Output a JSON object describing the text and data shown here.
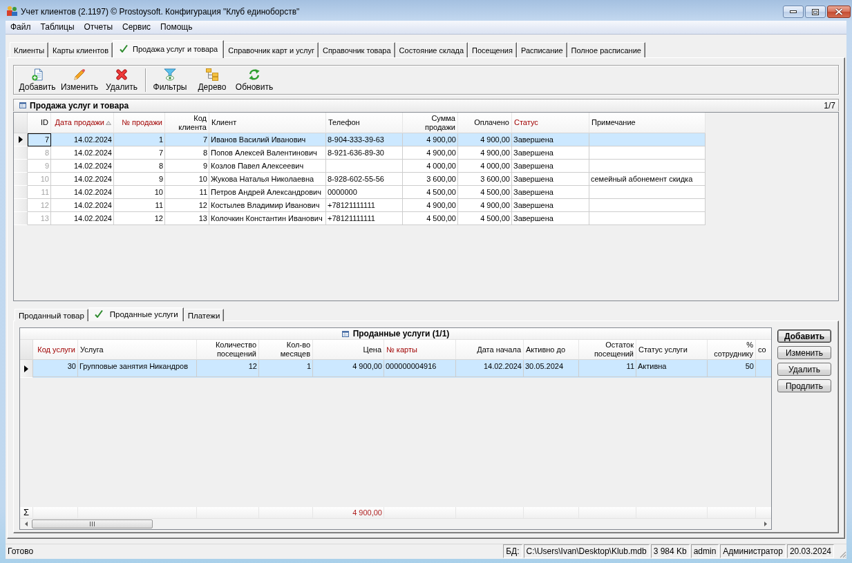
{
  "window": {
    "title": "Учет клиентов (2.1197) © Prostoysoft. Конфигурация \"Клуб единоборств\""
  },
  "menu": [
    {
      "label": "Файл"
    },
    {
      "label": "Таблицы"
    },
    {
      "label": "Отчеты"
    },
    {
      "label": "Сервис"
    },
    {
      "label": "Помощь"
    }
  ],
  "tabs": [
    {
      "label": "Клиенты",
      "selected": false
    },
    {
      "label": "Карты клиентов",
      "selected": false
    },
    {
      "label": "Продажа услуг и товара",
      "selected": true
    },
    {
      "label": "Справочник карт и услуг",
      "selected": false
    },
    {
      "label": "Справочник товара",
      "selected": false
    },
    {
      "label": "Состояние склада",
      "selected": false
    },
    {
      "label": "Посещения",
      "selected": false
    },
    {
      "label": "Расписание",
      "selected": false
    },
    {
      "label": "Полное расписание",
      "selected": false
    }
  ],
  "toolbar": {
    "groups": [
      [
        {
          "label": "Добавить",
          "kind": "add"
        },
        {
          "label": "Изменить",
          "kind": "edit"
        },
        {
          "label": "Удалить",
          "kind": "delete"
        }
      ],
      [
        {
          "label": "Фильтры",
          "kind": "filter"
        },
        {
          "label": "Дерево",
          "kind": "tree"
        },
        {
          "label": "Обновить",
          "kind": "refresh"
        }
      ]
    ]
  },
  "sales_panel": {
    "title": "Продажа услуг и товара",
    "counter": "1/7",
    "columns": [
      {
        "label": "ID",
        "highlighted": false,
        "sorted": false,
        "dimmed": true
      },
      {
        "label": "Дата продажи",
        "highlighted": true,
        "sorted": true,
        "dimmed": false
      },
      {
        "label": "№ продажи",
        "highlighted": true,
        "sorted": false,
        "dimmed": false
      },
      {
        "label": "Код\nклиента",
        "highlighted": false,
        "sorted": false,
        "dimmed": false
      },
      {
        "label": "Клиент",
        "highlighted": false,
        "sorted": false,
        "dimmed": false
      },
      {
        "label": "Телефон",
        "highlighted": false,
        "sorted": false,
        "dimmed": false
      },
      {
        "label": "Сумма\nпродажи",
        "highlighted": false,
        "sorted": false,
        "dimmed": false
      },
      {
        "label": "Оплачено",
        "highlighted": false,
        "sorted": false,
        "dimmed": false
      },
      {
        "label": "Статус",
        "highlighted": true,
        "sorted": false,
        "dimmed": false
      },
      {
        "label": "Примечание",
        "highlighted": false,
        "sorted": false,
        "dimmed": false
      }
    ],
    "rows": [
      {
        "selected": true,
        "cells": [
          "7",
          "14.02.2024",
          "1",
          "7",
          "Иванов Василий Иванович",
          "8-904-333-39-63",
          "4 900,00",
          "4 900,00",
          "Завершена",
          null
        ]
      },
      {
        "selected": false,
        "cells": [
          "8",
          "14.02.2024",
          "7",
          "8",
          "Попов Алексей Валентинович",
          "8-921-636-89-30",
          "4 900,00",
          "4 900,00",
          "Завершена",
          null
        ]
      },
      {
        "selected": false,
        "cells": [
          "9",
          "14.02.2024",
          "8",
          "9",
          "Козлов Павел Алексеевич",
          null,
          "4 000,00",
          "4 000,00",
          "Завершена",
          null
        ]
      },
      {
        "selected": false,
        "cells": [
          "10",
          "14.02.2024",
          "9",
          "10",
          "Жукова Наталья Николаевна",
          "8-928-602-55-56",
          "3 600,00",
          "3 600,00",
          "Завершена",
          "семейный абонемент скидка"
        ]
      },
      {
        "selected": false,
        "cells": [
          "11",
          "14.02.2024",
          "10",
          "11",
          "Петров Андрей Александрович",
          "0000000",
          "4 500,00",
          "4 500,00",
          "Завершена",
          null
        ]
      },
      {
        "selected": false,
        "cells": [
          "12",
          "14.02.2024",
          "11",
          "12",
          "Костылев Владимир Иванович",
          "+78121111111",
          "4 900,00",
          "4 900,00",
          "Завершена",
          null
        ]
      },
      {
        "selected": false,
        "cells": [
          "13",
          "14.02.2024",
          "12",
          "13",
          "Колочкин Константин Иванович",
          "+78121111111",
          "4 500,00",
          "4 500,00",
          "Завершена",
          null
        ]
      }
    ]
  },
  "detail_tabs": [
    {
      "label": "Проданный товар",
      "selected": false
    },
    {
      "label": "Проданные услуги",
      "selected": true
    },
    {
      "label": "Платежи",
      "selected": false
    }
  ],
  "services_panel": {
    "title": "Проданные услуги (1/1)",
    "totals_label": "Σ",
    "columns": [
      {
        "label": "Код услуги",
        "highlighted": true
      },
      {
        "label": "Услуга",
        "highlighted": false
      },
      {
        "label": "Количество\nпосещений",
        "highlighted": false
      },
      {
        "label": "Кол-во\nмесяцев",
        "highlighted": false
      },
      {
        "label": "Цена",
        "highlighted": false,
        "total": "4 900,00"
      },
      {
        "label": "№ карты",
        "highlighted": true
      },
      {
        "label": "Дата начала",
        "highlighted": false
      },
      {
        "label": "Активно до",
        "highlighted": false
      },
      {
        "label": "Остаток\nпосещений",
        "highlighted": false
      },
      {
        "label": "Статус услуги",
        "highlighted": false
      },
      {
        "label": "%\nсотруднику",
        "highlighted": false
      },
      {
        "label": "со",
        "highlighted": false
      }
    ],
    "rows": [
      {
        "selected": true,
        "cells": [
          "30",
          "Групповые занятия Никандров",
          "12",
          "1",
          "4 900,00",
          "000000004916",
          "14.02.2024",
          "30.05.2024",
          "11",
          "Активна",
          "50",
          null
        ]
      }
    ]
  },
  "service_buttons": [
    {
      "label": "Добавить",
      "default": true
    },
    {
      "label": "Изменить",
      "default": false
    },
    {
      "label": "Удалить",
      "default": false
    },
    {
      "label": "Продлить",
      "default": false
    }
  ],
  "status_bar": {
    "message": "Готово",
    "fields": [
      "БД:",
      "C:\\Users\\Ivan\\Desktop\\Klub.mdb",
      "3 984 Kb",
      "admin",
      "Администратор",
      "20.03.2024"
    ]
  }
}
